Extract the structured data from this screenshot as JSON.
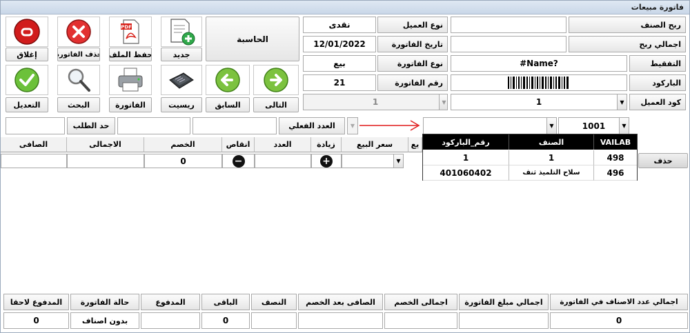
{
  "window": {
    "title": "فاتورة مبيعات"
  },
  "toolbar": {
    "new_label": "جديد",
    "save_label": "حفظ الملف",
    "delete_label": "حذف الفاتورة",
    "close_label": "إغلاق",
    "receipt_label": "ريسيت",
    "invoice_label": "الفاتورة",
    "search_label": "البحث",
    "edit_label": "التعديل",
    "next_label": "التالى",
    "prev_label": "السابق",
    "calculator_label": "الحاسبة",
    "pdf_text": "PDF"
  },
  "invoice": {
    "customer_type_label": "نوع العميل",
    "customer_type_value": "نقدى",
    "date_label": "تاريخ الفاتورة",
    "date_value": "12/01/2022",
    "type_label": "نوع الفاتورة",
    "type_value": "بيع",
    "number_label": "رقم الفاتورة",
    "number_value": "21",
    "disabled_value": "1"
  },
  "item": {
    "profit_label": "ربح الصنف",
    "profit_value": "",
    "total_profit_label": "اجمالي ربح",
    "total_profit_value": "",
    "tafqeet_label": "التفقيط",
    "tafqeet_value": "#Name?",
    "barcode_label": "الباركود",
    "customer_code_label": "كود العميل",
    "customer_code_value": "1"
  },
  "entry": {
    "item_combo_value": "1001",
    "actual_qty_label": "العدد الفعلي",
    "limit_label": "حد الطلب"
  },
  "popup": {
    "headers": [
      "VAILAB",
      "الصنف",
      "رقم_الباركود"
    ],
    "rows": [
      [
        "498",
        "1",
        "1"
      ],
      [
        "496",
        "سلاح التلميذ ثنف",
        "401060402"
      ]
    ]
  },
  "grid": {
    "headers": {
      "net": "الصافى",
      "total": "الاجمالى",
      "discount": "الخصم",
      "decrease": "انقاص",
      "count": "العدد",
      "increase": "زيادة",
      "price": "سعر البيع",
      "partial": "يع"
    },
    "row": {
      "discount": "0"
    },
    "delete_label": "حذف"
  },
  "summary": {
    "headers": [
      "اجمالي عدد الاصناف في الفاتورة",
      "اجمالي مبلغ الفاتورة",
      "اجمالى الخصم",
      "الصافى بعد الخصم",
      "النصف",
      "الباقى",
      "المدفوع",
      "حالة الفاتورة",
      "المدفوع لاحقا"
    ],
    "values": [
      "0",
      "",
      "",
      "",
      "",
      "0",
      "",
      "بدون اصناف",
      "0"
    ]
  }
}
